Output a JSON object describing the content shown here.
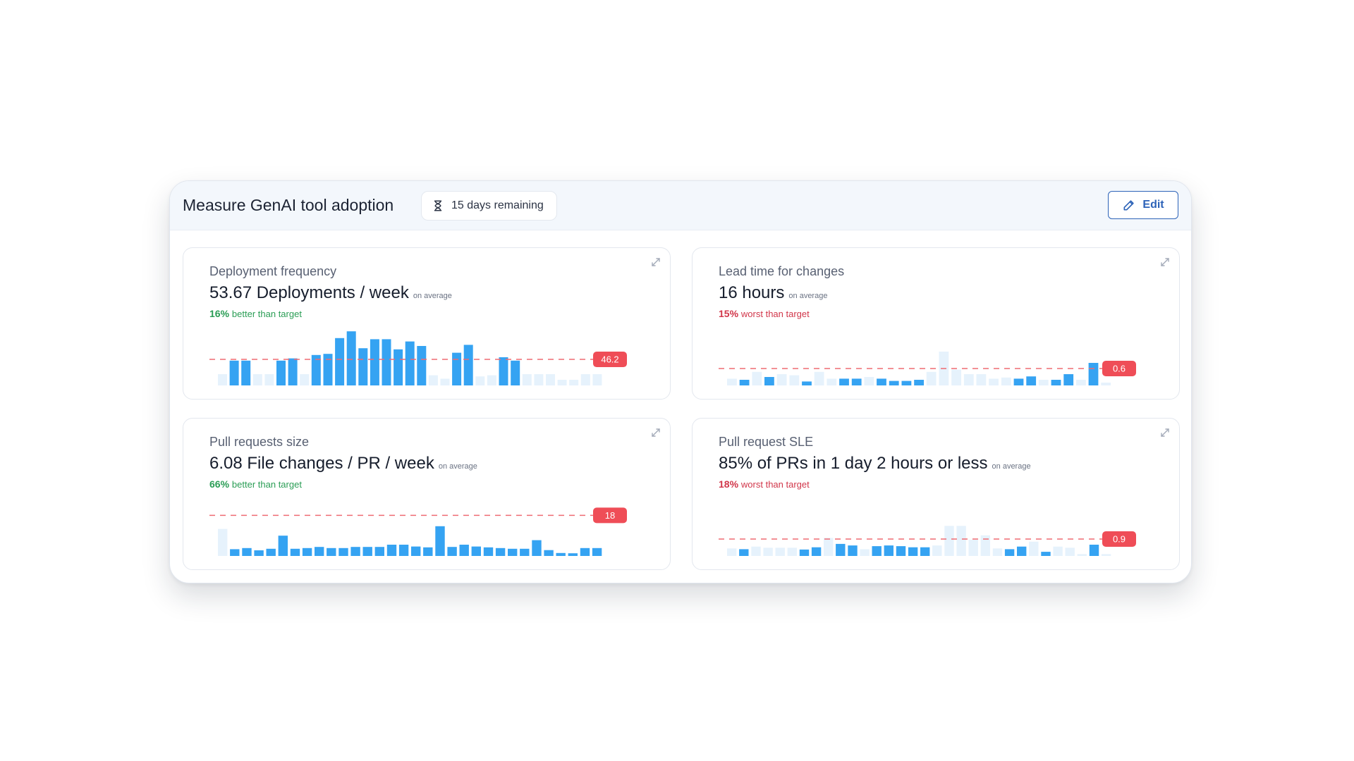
{
  "header": {
    "title": "Measure GenAI tool adoption",
    "days_remaining": "15 days remaining",
    "edit_label": "Edit"
  },
  "colors": {
    "bar": "#35a3f2",
    "bar_faint": "#e6f2fc",
    "target_line": "#ef6b72",
    "target_badge": "#ef4d57",
    "good": "#2a9d55",
    "bad": "#d1364a",
    "edit_accent": "#2d63b8"
  },
  "cards": [
    {
      "title": "Deployment frequency",
      "value": "53.67 Deployments / week",
      "value_suffix": "on average",
      "delta_pct": "16%",
      "delta_text": "better than target",
      "delta_status": "good"
    },
    {
      "title": "Lead time for changes",
      "value": "16 hours",
      "value_suffix": "on average",
      "delta_pct": "15%",
      "delta_text": "worst than target",
      "delta_status": "bad"
    },
    {
      "title": "Pull requests size",
      "value": "6.08 File changes / PR / week",
      "value_suffix": "on average",
      "delta_pct": "66%",
      "delta_text": "better than target",
      "delta_status": "good"
    },
    {
      "title": "Pull request SLE",
      "value": "85% of PRs in 1 day 2 hours or less",
      "value_suffix": "on average",
      "delta_pct": "18%",
      "delta_text": "worst than target",
      "delta_status": "bad"
    }
  ],
  "chart_data": [
    {
      "type": "bar",
      "target": 46.2,
      "target_label": "46.2",
      "ylim": [
        0,
        100
      ],
      "values": [
        20,
        44,
        44,
        20,
        20,
        44,
        48,
        20,
        54,
        56,
        84,
        96,
        66,
        82,
        82,
        64,
        78,
        70,
        18,
        12,
        58,
        72,
        16,
        18,
        50,
        44,
        20,
        20,
        20,
        10,
        10,
        20,
        20
      ],
      "highlighted": [
        false,
        true,
        true,
        false,
        false,
        true,
        true,
        false,
        true,
        true,
        true,
        true,
        true,
        true,
        true,
        true,
        true,
        true,
        false,
        false,
        true,
        true,
        false,
        false,
        true,
        true,
        false,
        false,
        false,
        false,
        false,
        false,
        false
      ]
    },
    {
      "type": "bar",
      "target": 0.6,
      "target_label": "0.6",
      "ylim": [
        0,
        2
      ],
      "values": [
        0.24,
        0.2,
        0.48,
        0.3,
        0.4,
        0.36,
        0.14,
        0.48,
        0.24,
        0.24,
        0.24,
        0.3,
        0.24,
        0.16,
        0.16,
        0.2,
        0.48,
        1.2,
        0.56,
        0.4,
        0.4,
        0.24,
        0.28,
        0.24,
        0.32,
        0.2,
        0.2,
        0.4,
        0.2,
        0.8,
        0.1
      ],
      "highlighted": [
        false,
        true,
        false,
        true,
        false,
        false,
        true,
        false,
        false,
        true,
        true,
        false,
        true,
        true,
        true,
        true,
        false,
        false,
        false,
        false,
        false,
        false,
        false,
        true,
        true,
        false,
        true,
        true,
        false,
        true,
        false
      ]
    },
    {
      "type": "bar",
      "target": 18,
      "target_label": "18",
      "ylim": [
        0,
        25
      ],
      "values": [
        12,
        3,
        3.5,
        2.5,
        3.2,
        9,
        3.2,
        3.5,
        4,
        3.5,
        3.5,
        4,
        4,
        4,
        5,
        5,
        4.2,
        3.8,
        13.2,
        4,
        5,
        4.2,
        3.8,
        3.5,
        3.2,
        3.2,
        7,
        2.6,
        1.3,
        1.2,
        3.5,
        3.5
      ],
      "highlighted": [
        false,
        true,
        true,
        true,
        true,
        true,
        true,
        true,
        true,
        true,
        true,
        true,
        true,
        true,
        true,
        true,
        true,
        true,
        true,
        true,
        true,
        true,
        true,
        true,
        true,
        true,
        true,
        true,
        true,
        true,
        true,
        true
      ]
    },
    {
      "type": "bar",
      "target": 0.9,
      "target_label": "0.9",
      "ylim": [
        0,
        3
      ],
      "values": [
        0.4,
        0.36,
        0.5,
        0.44,
        0.44,
        0.44,
        0.34,
        0.46,
        0.96,
        0.64,
        0.56,
        0.36,
        0.52,
        0.56,
        0.52,
        0.46,
        0.46,
        0.56,
        1.6,
        1.6,
        0.86,
        1.1,
        0.4,
        0.36,
        0.5,
        0.76,
        0.22,
        0.5,
        0.44,
        0.1,
        0.6,
        0.1
      ],
      "highlighted": [
        false,
        true,
        false,
        false,
        false,
        false,
        true,
        true,
        false,
        true,
        true,
        false,
        true,
        true,
        true,
        true,
        true,
        false,
        false,
        false,
        false,
        false,
        false,
        true,
        true,
        false,
        true,
        false,
        false,
        false,
        true,
        false
      ]
    }
  ]
}
